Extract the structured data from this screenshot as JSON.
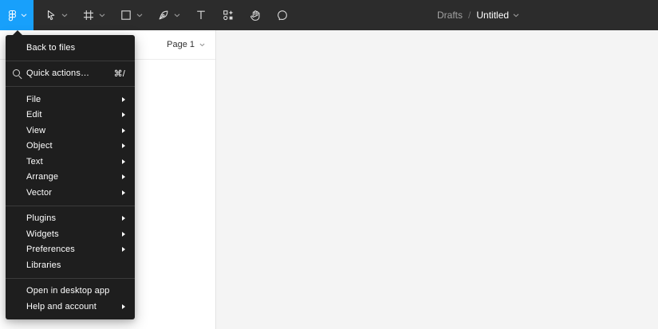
{
  "app": {
    "name": "Figma"
  },
  "colors": {
    "accent_blue": "#18a0fb",
    "toolbar_bg": "#2c2c2c",
    "menu_bg": "#1e1e1e",
    "panel_bg": "#ffffff",
    "canvas_bg": "#f4f4f4"
  },
  "toolbar": {
    "tools": [
      {
        "name": "main-menu",
        "icon": "figma-logo-icon",
        "has_dropdown": true,
        "active": true
      },
      {
        "name": "move-tool",
        "icon": "cursor-icon",
        "has_dropdown": true
      },
      {
        "name": "frame-tool",
        "icon": "frame-icon",
        "has_dropdown": true
      },
      {
        "name": "shape-tool",
        "icon": "rectangle-icon",
        "has_dropdown": true
      },
      {
        "name": "pen-tool",
        "icon": "pen-icon",
        "has_dropdown": true
      },
      {
        "name": "text-tool",
        "icon": "text-icon",
        "has_dropdown": false
      },
      {
        "name": "resources-tool",
        "icon": "actions-icon",
        "has_dropdown": false
      },
      {
        "name": "hand-tool",
        "icon": "hand-icon",
        "has_dropdown": false
      },
      {
        "name": "comment-tool",
        "icon": "comment-icon",
        "has_dropdown": false
      }
    ],
    "breadcrumb": {
      "folder": "Drafts",
      "divider": "/",
      "file_name": "Untitled"
    }
  },
  "menu": {
    "sections": [
      {
        "items": [
          {
            "label": "Back to files"
          }
        ]
      },
      {
        "items": [
          {
            "label": "Quick actions…",
            "icon": "search",
            "shortcut": "⌘/"
          }
        ]
      },
      {
        "items": [
          {
            "label": "File",
            "submenu": true
          },
          {
            "label": "Edit",
            "submenu": true
          },
          {
            "label": "View",
            "submenu": true
          },
          {
            "label": "Object",
            "submenu": true
          },
          {
            "label": "Text",
            "submenu": true
          },
          {
            "label": "Arrange",
            "submenu": true
          },
          {
            "label": "Vector",
            "submenu": true
          }
        ]
      },
      {
        "items": [
          {
            "label": "Plugins",
            "submenu": true
          },
          {
            "label": "Widgets",
            "submenu": true
          },
          {
            "label": "Preferences",
            "submenu": true
          },
          {
            "label": "Libraries"
          }
        ]
      },
      {
        "items": [
          {
            "label": "Open in desktop app"
          },
          {
            "label": "Help and account",
            "submenu": true
          }
        ]
      }
    ]
  },
  "sidebar": {
    "page_selector": {
      "label": "Page 1"
    }
  }
}
